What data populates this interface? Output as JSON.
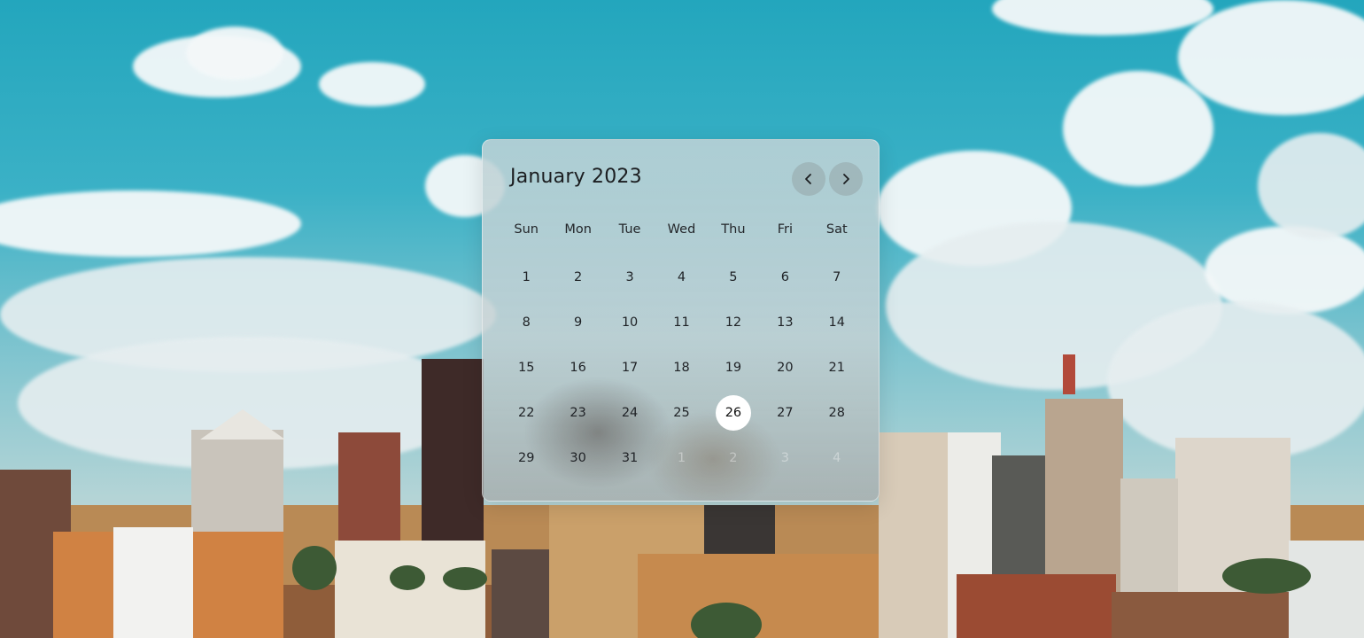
{
  "calendar": {
    "title": "January 2023",
    "prev_icon": "chevron-left-icon",
    "next_icon": "chevron-right-icon",
    "weekdays": [
      "Sun",
      "Mon",
      "Tue",
      "Wed",
      "Thu",
      "Fri",
      "Sat"
    ],
    "days": [
      {
        "label": "1"
      },
      {
        "label": "2"
      },
      {
        "label": "3"
      },
      {
        "label": "4"
      },
      {
        "label": "5"
      },
      {
        "label": "6"
      },
      {
        "label": "7"
      },
      {
        "label": "8"
      },
      {
        "label": "9"
      },
      {
        "label": "10"
      },
      {
        "label": "11"
      },
      {
        "label": "12"
      },
      {
        "label": "13"
      },
      {
        "label": "14"
      },
      {
        "label": "15"
      },
      {
        "label": "16"
      },
      {
        "label": "17"
      },
      {
        "label": "18"
      },
      {
        "label": "19"
      },
      {
        "label": "20"
      },
      {
        "label": "21"
      },
      {
        "label": "22"
      },
      {
        "label": "23"
      },
      {
        "label": "24"
      },
      {
        "label": "25"
      },
      {
        "label": "26",
        "selected": true
      },
      {
        "label": "27"
      },
      {
        "label": "28"
      },
      {
        "label": "29"
      },
      {
        "label": "30"
      },
      {
        "label": "31"
      },
      {
        "label": "1",
        "muted": true
      },
      {
        "label": "2",
        "muted": true
      },
      {
        "label": "3",
        "muted": true
      },
      {
        "label": "4",
        "muted": true
      }
    ],
    "colors": {
      "selected_bg": "#ffffff",
      "text": "#1f2226"
    }
  },
  "background": {
    "description_icon": "city-skyline-photo"
  }
}
